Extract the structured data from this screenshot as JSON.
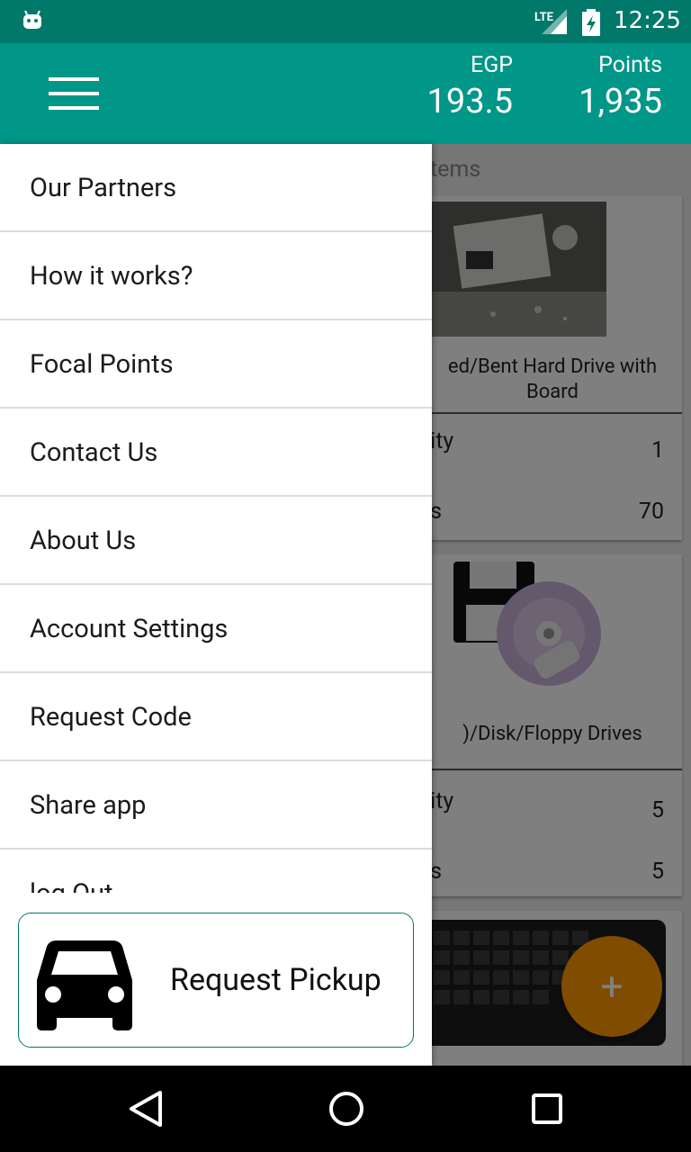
{
  "status_bar": {
    "network": "LTE",
    "time": "12:25"
  },
  "app_bar": {
    "egp_label": "EGP",
    "egp_value": "193.5",
    "points_label": "Points",
    "points_value": "1,935"
  },
  "background": {
    "section_title": "tems",
    "cards": [
      {
        "title": "ed/Bent Hard Drive with Board",
        "quantity_label": "tity",
        "quantity_value": "1",
        "points_label": "ts",
        "points_value": "70"
      },
      {
        "title": ")/Disk/Floppy Drives",
        "quantity_label": "tity",
        "quantity_value": "5",
        "points_label": "ts",
        "points_value": "5"
      }
    ],
    "fab_label": "+"
  },
  "drawer": {
    "items": [
      {
        "label": "Our Partners"
      },
      {
        "label": "How it works?"
      },
      {
        "label": "Focal Points"
      },
      {
        "label": "Contact Us"
      },
      {
        "label": "About Us"
      },
      {
        "label": "Account Settings"
      },
      {
        "label": "Request Code"
      },
      {
        "label": "Share app"
      },
      {
        "label": "log Out"
      }
    ],
    "pickup_label": "Request Pickup"
  },
  "colors": {
    "primary": "#009688",
    "primary_dark": "#00786a",
    "fab": "#ff9800"
  }
}
